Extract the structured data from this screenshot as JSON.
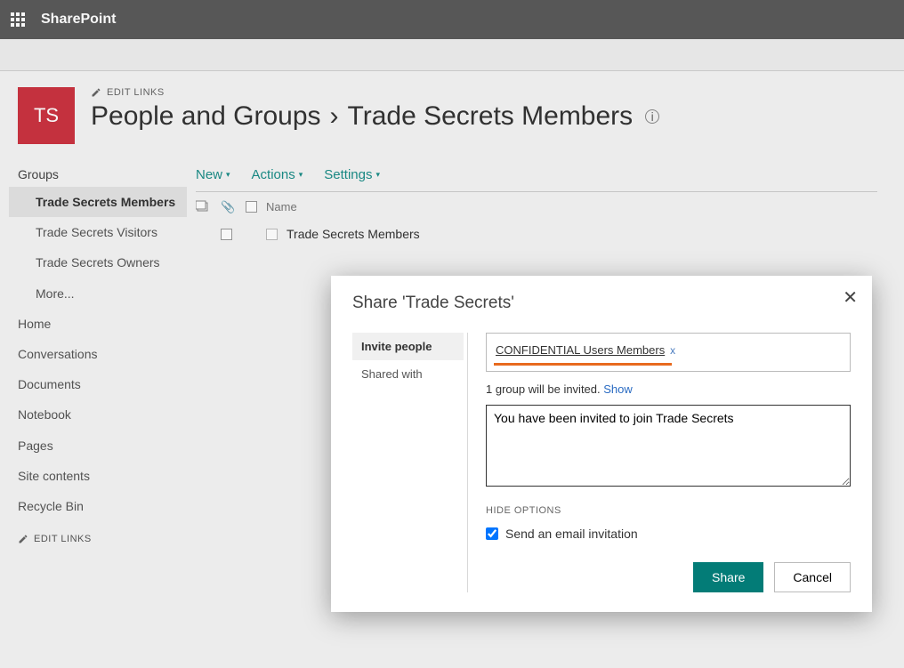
{
  "suite": {
    "product": "SharePoint"
  },
  "header": {
    "edit_links": "EDIT LINKS",
    "site_initials": "TS",
    "breadcrumb_root": "People and Groups",
    "breadcrumb_sep": "›",
    "breadcrumb_current": "Trade Secrets Members"
  },
  "sidebar": {
    "heading": "Groups",
    "groups": [
      {
        "label": "Trade Secrets Members",
        "selected": true
      },
      {
        "label": "Trade Secrets Visitors",
        "selected": false
      },
      {
        "label": "Trade Secrets Owners",
        "selected": false
      },
      {
        "label": "More...",
        "selected": false
      }
    ],
    "links": [
      {
        "label": "Home"
      },
      {
        "label": "Conversations"
      },
      {
        "label": "Documents"
      },
      {
        "label": "Notebook"
      },
      {
        "label": "Pages"
      },
      {
        "label": "Site contents"
      },
      {
        "label": "Recycle Bin"
      }
    ],
    "edit_links": "EDIT LINKS"
  },
  "toolbar": {
    "new": "New",
    "actions": "Actions",
    "settings": "Settings"
  },
  "list": {
    "col_name": "Name",
    "rows": [
      {
        "name": "Trade Secrets Members"
      }
    ]
  },
  "modal": {
    "title": "Share 'Trade Secrets'",
    "tabs": {
      "invite": "Invite people",
      "shared": "Shared with"
    },
    "people_chip": "CONFIDENTIAL Users Members",
    "chip_remove": "x",
    "status_count": "1 group will be invited.",
    "status_show": "Show",
    "message": "You have been invited to join Trade Secrets",
    "hide_options": "HIDE OPTIONS",
    "email_label": "Send an email invitation",
    "share_btn": "Share",
    "cancel_btn": "Cancel"
  }
}
